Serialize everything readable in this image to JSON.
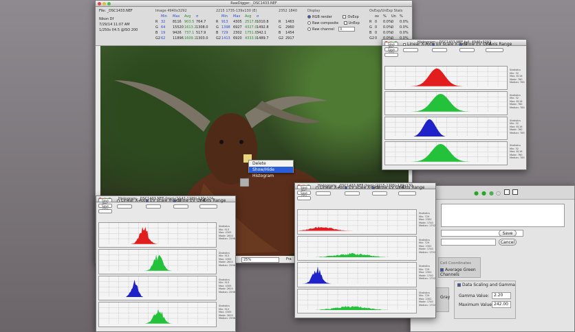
{
  "main": {
    "title": "RawDigger: _DSC1433.NEF",
    "file_label": "File:",
    "file_name": "_DSC1433.NEF",
    "camera": "Nikon Df",
    "date": "7/29/14 11:07 AM",
    "exposure": "1/250s f/4.5 @ISO 200",
    "image_hdr": "Image 4940x3292",
    "sel_hdr": "2215 1735-139x130 (E)",
    "px_hdr": "2352 1840",
    "col_headers": [
      "Min",
      "Max",
      "Avg",
      "σ"
    ],
    "channels": [
      "R",
      "G",
      "B",
      "G2"
    ],
    "image_rows": [
      [
        "32",
        "8116",
        "903.5",
        "764.7"
      ],
      [
        "64",
        "15520",
        "1613.2",
        "1308.0"
      ],
      [
        "19",
        "9426",
        "737.1",
        "517.9"
      ],
      [
        "62",
        "11896",
        "1609.1",
        "1303.0"
      ]
    ],
    "sel_rows": [
      [
        "913",
        "4305",
        "2517.8",
        "1010.8"
      ],
      [
        "1398",
        "6927",
        "4327.0",
        "1492.8"
      ],
      [
        "729",
        "2302",
        "1751.8",
        "342.1"
      ],
      [
        "1413",
        "6920",
        "4333.9",
        "1489.7"
      ]
    ],
    "px_rows": [
      [
        "R",
        "1463"
      ],
      [
        "G",
        "2960"
      ],
      [
        "B",
        "1454"
      ],
      [
        "G2",
        "2917"
      ]
    ],
    "display": {
      "title": "Display",
      "opt1": "RGB render",
      "opt2": "Raw composite",
      "opt3": "Raw channel",
      "ovexp": "OvExp",
      "unexp": "UnExp",
      "chan_sel": "R"
    },
    "ovexp_stats": {
      "title": "OvExp/UnExp Stats",
      "rows": [
        [
          "R",
          "0",
          "0.0%",
          "0",
          "0.0%"
        ],
        [
          "G",
          "0",
          "0.0%",
          "0",
          "0.0%"
        ],
        [
          "B",
          "0",
          "0.0%",
          "0",
          "0.0%"
        ],
        [
          "G2",
          "0",
          "0.0%",
          "0",
          "0.0%"
        ]
      ],
      "sub": [
        "ov",
        "%",
        "Un",
        "%"
      ]
    },
    "zoom": "25%",
    "status": "Fra"
  },
  "menu": {
    "delete": "Delete",
    "show_hide": "Show/Hide Histogram"
  },
  "histograms": [
    {
      "title": "Histogram: _DSC1433.NEF full: 4940x3292",
      "linear_x": "Linear X-Axis",
      "log_y": "EV scale X-Axis",
      "grid": "Show EV Grid",
      "yrange": "Y-Axis Range",
      "save": "Save PNG",
      "save_csv": "Save CSV",
      "stats": [
        "Statistics",
        "Min: 32",
        "Max: 8116",
        "Mode: 760",
        "Median: 785"
      ],
      "channels": [
        "R",
        "G",
        "B",
        "G2"
      ]
    },
    {
      "title": "Histogram: _DSC1433.NEF (Img)-(1142-1239)-130x124",
      "linear_x": "Linear X-Axis",
      "log_y": "EV scale X-Axis",
      "grid": "Show EV Grid",
      "yrange": "Y-Axis Range",
      "save": "Save PNG",
      "save_csv": "Save CSV",
      "stats": [
        "Statistics",
        "Min: 913",
        "Max: 4305",
        "Mode: 2610",
        "Median: 2598"
      ],
      "channels": [
        "R",
        "G",
        "B",
        "G2"
      ]
    },
    {
      "title": "Histogram: _DSC1433.NEF (Img)-(2215-1735)-139x130",
      "linear_x": "Linear X-Axis",
      "log_y": "EV scale X-Axis",
      "grid": "Show EV Grid",
      "yrange": "Y-Axis Range",
      "save": "Save PNG",
      "save_csv": "Save CSV",
      "stats": [
        "Statistics",
        "Min: 729",
        "Max: 2302",
        "Mode: 1740",
        "Median: 1752"
      ],
      "channels": [
        "R",
        "G",
        "B",
        "G2"
      ]
    }
  ],
  "settings": {
    "save": "Save",
    "cancel": "Cancel",
    "cell_coords": "Cell Coordinates",
    "avg_green": "Average Green Channels",
    "gray_tab": "Gray",
    "data_scaling": "Data Scaling and Gamma",
    "gamma_label": "Gamma Value:",
    "gamma": "2.20",
    "max_label": "Maximum Value:",
    "max": "242.00"
  },
  "colors": {
    "red": "#e21d1d",
    "green": "#23c23a",
    "blue": "#1f22c8"
  }
}
